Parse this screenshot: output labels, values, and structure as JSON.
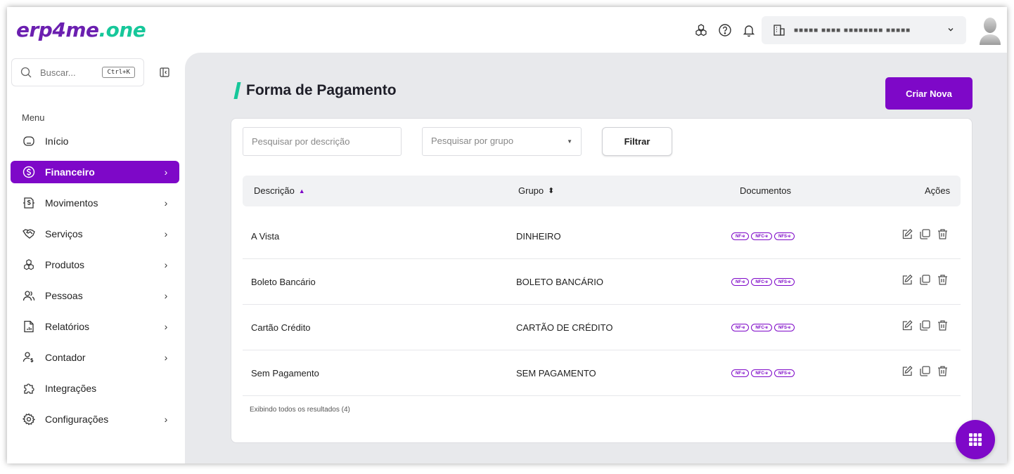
{
  "brand": {
    "part1": "erp4me",
    "part2": ".one"
  },
  "topbar": {
    "company_name": "■■■■■ ■■■■ ■■■■■■■■ ■■■■■",
    "icons": [
      "cubes-icon",
      "help-icon",
      "bell-icon",
      "building-icon",
      "chevron-down-icon",
      "avatar"
    ]
  },
  "sidebar": {
    "search_placeholder": "Buscar...",
    "shortcut": "Ctrl+K",
    "menu_label": "Menu",
    "items": [
      {
        "label": "Início",
        "icon": "home-icon",
        "arrow": false,
        "active": false
      },
      {
        "label": "Financeiro",
        "icon": "dollar-icon",
        "arrow": true,
        "active": true
      },
      {
        "label": "Movimentos",
        "icon": "exchange-icon",
        "arrow": true,
        "active": false
      },
      {
        "label": "Serviços",
        "icon": "handshake-icon",
        "arrow": true,
        "active": false
      },
      {
        "label": "Produtos",
        "icon": "cubes-icon",
        "arrow": true,
        "active": false
      },
      {
        "label": "Pessoas",
        "icon": "users-icon",
        "arrow": true,
        "active": false
      },
      {
        "label": "Relatórios",
        "icon": "report-icon",
        "arrow": true,
        "active": false
      },
      {
        "label": "Contador",
        "icon": "accountant-icon",
        "arrow": true,
        "active": false
      },
      {
        "label": "Integrações",
        "icon": "puzzle-icon",
        "arrow": false,
        "active": false
      },
      {
        "label": "Configurações",
        "icon": "gear-icon",
        "arrow": true,
        "active": false
      }
    ]
  },
  "page": {
    "title": "Forma de Pagamento",
    "create_button": "Criar Nova"
  },
  "filters": {
    "description_placeholder": "Pesquisar por descrição",
    "group_placeholder": "Pesquisar por grupo",
    "filter_button": "Filtrar"
  },
  "table": {
    "columns": [
      "Descrição",
      "Grupo",
      "Documentos",
      "Ações"
    ],
    "document_badges": [
      "NF-e",
      "NFC-e",
      "NFS-e"
    ],
    "rows": [
      {
        "descricao": "A Vista",
        "grupo": "DINHEIRO"
      },
      {
        "descricao": "Boleto Bancário",
        "grupo": "BOLETO BANCÁRIO"
      },
      {
        "descricao": "Cartão Crédito",
        "grupo": "CARTÃO DE CRÉDITO"
      },
      {
        "descricao": "Sem Pagamento",
        "grupo": "SEM PAGAMENTO"
      }
    ],
    "footer": "Exibindo todos os resultados (4)"
  },
  "colors": {
    "accent": "#7e08c8",
    "brand_green": "#16c79a",
    "brand_purple": "#6b1fb0"
  }
}
